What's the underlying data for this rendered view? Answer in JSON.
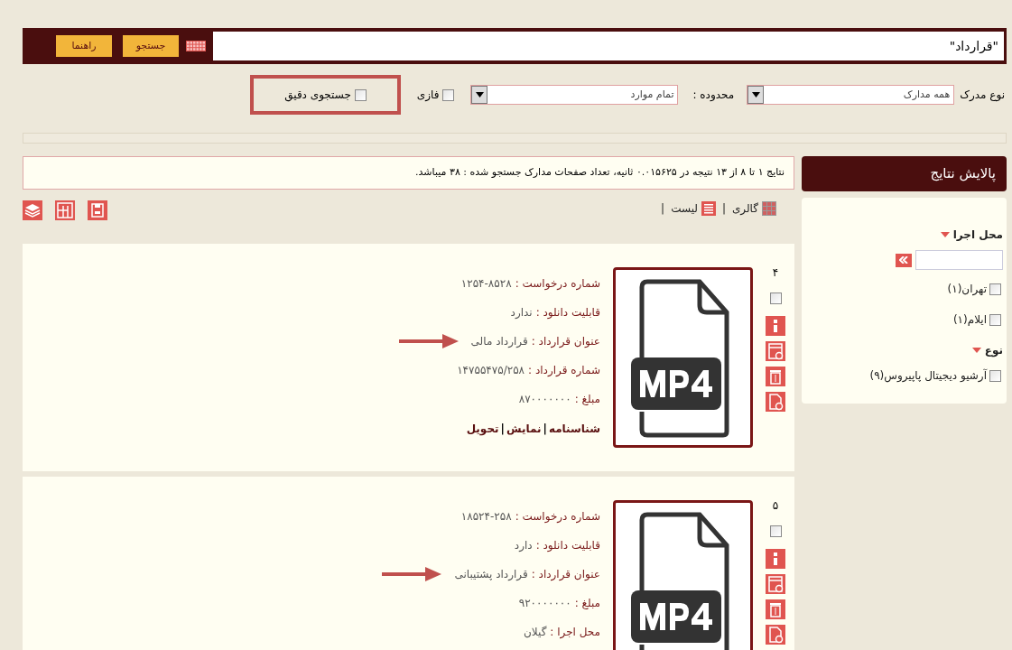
{
  "search": {
    "value": "\"قرارداد\"",
    "buttons": [
      "جستجو",
      "راهنما"
    ]
  },
  "options": {
    "doc_type_label": "نوع مدرک",
    "doc_type_value": "همه مدارک",
    "scope_label": "محدوده :",
    "scope_value": "تمام موارد",
    "checks": [
      {
        "label": "فازی",
        "checked": false,
        "highlighted": false
      },
      {
        "label": "جستجوی دقیق",
        "checked": false,
        "highlighted": true
      }
    ]
  },
  "summary": "نتایج ۱ تا ۸ از ۱۳ نتیجه در ۰.۰۱۵۶۲۵ ثانیه، تعداد صفحات مدارک جستجو شده : ۳۸ میباشد.",
  "views": [
    {
      "label": "گالری",
      "kind": "gallery",
      "separator": "|"
    },
    {
      "label": "لیست",
      "kind": "list",
      "separator": "|"
    }
  ],
  "results": [
    {
      "number": "۴",
      "checked": false,
      "fields": [
        {
          "label": "شماره درخواست :",
          "value": "۱۲۵۴-۸۵۲۸",
          "marked": false
        },
        {
          "label": "قابلیت دانلود :",
          "value": "ندارد",
          "marked": false
        },
        {
          "label": "عنوان قرارداد :",
          "value": "قرارداد مالی",
          "marked": true
        },
        {
          "label": "شماره قرارداد :",
          "value": "۱۴۷۵۵۴۷۵/۲۵۸",
          "marked": false
        },
        {
          "label": "مبلغ :",
          "value": "۸۷۰۰۰۰۰۰۰",
          "marked": false
        }
      ],
      "links": [
        {
          "label": "شناسنامه"
        },
        {
          "separator": "|",
          "label": "نمایش"
        },
        {
          "separator": "|",
          "label": "تحویل"
        }
      ]
    },
    {
      "number": "۵",
      "checked": false,
      "fields": [
        {
          "label": "شماره درخواست :",
          "value": "۱۸۵۲۴-۲۵۸",
          "marked": false
        },
        {
          "label": "قابلیت دانلود :",
          "value": "دارد",
          "marked": false
        },
        {
          "label": "عنوان قرارداد :",
          "value": "قرارداد پشتیبانی",
          "marked": true
        },
        {
          "label": "مبلغ :",
          "value": "۹۲۰۰۰۰۰۰۰",
          "marked": false
        },
        {
          "label": "محل اجرا :",
          "value": "گیلان",
          "marked": false
        }
      ]
    }
  ],
  "sidebar": {
    "title": "پالایش نتایج",
    "facets": [
      {
        "title": "محل اجرا",
        "has_search": true,
        "items": [
          {
            "label": "تهران(۱)",
            "checked": false
          },
          {
            "label": "ایلام(۱)",
            "checked": false
          }
        ]
      },
      {
        "title": "نوع",
        "has_search": false,
        "items": [
          {
            "label": "آرشیو دیجیتال پاپیروس(۹)",
            "checked": false
          }
        ]
      }
    ]
  }
}
